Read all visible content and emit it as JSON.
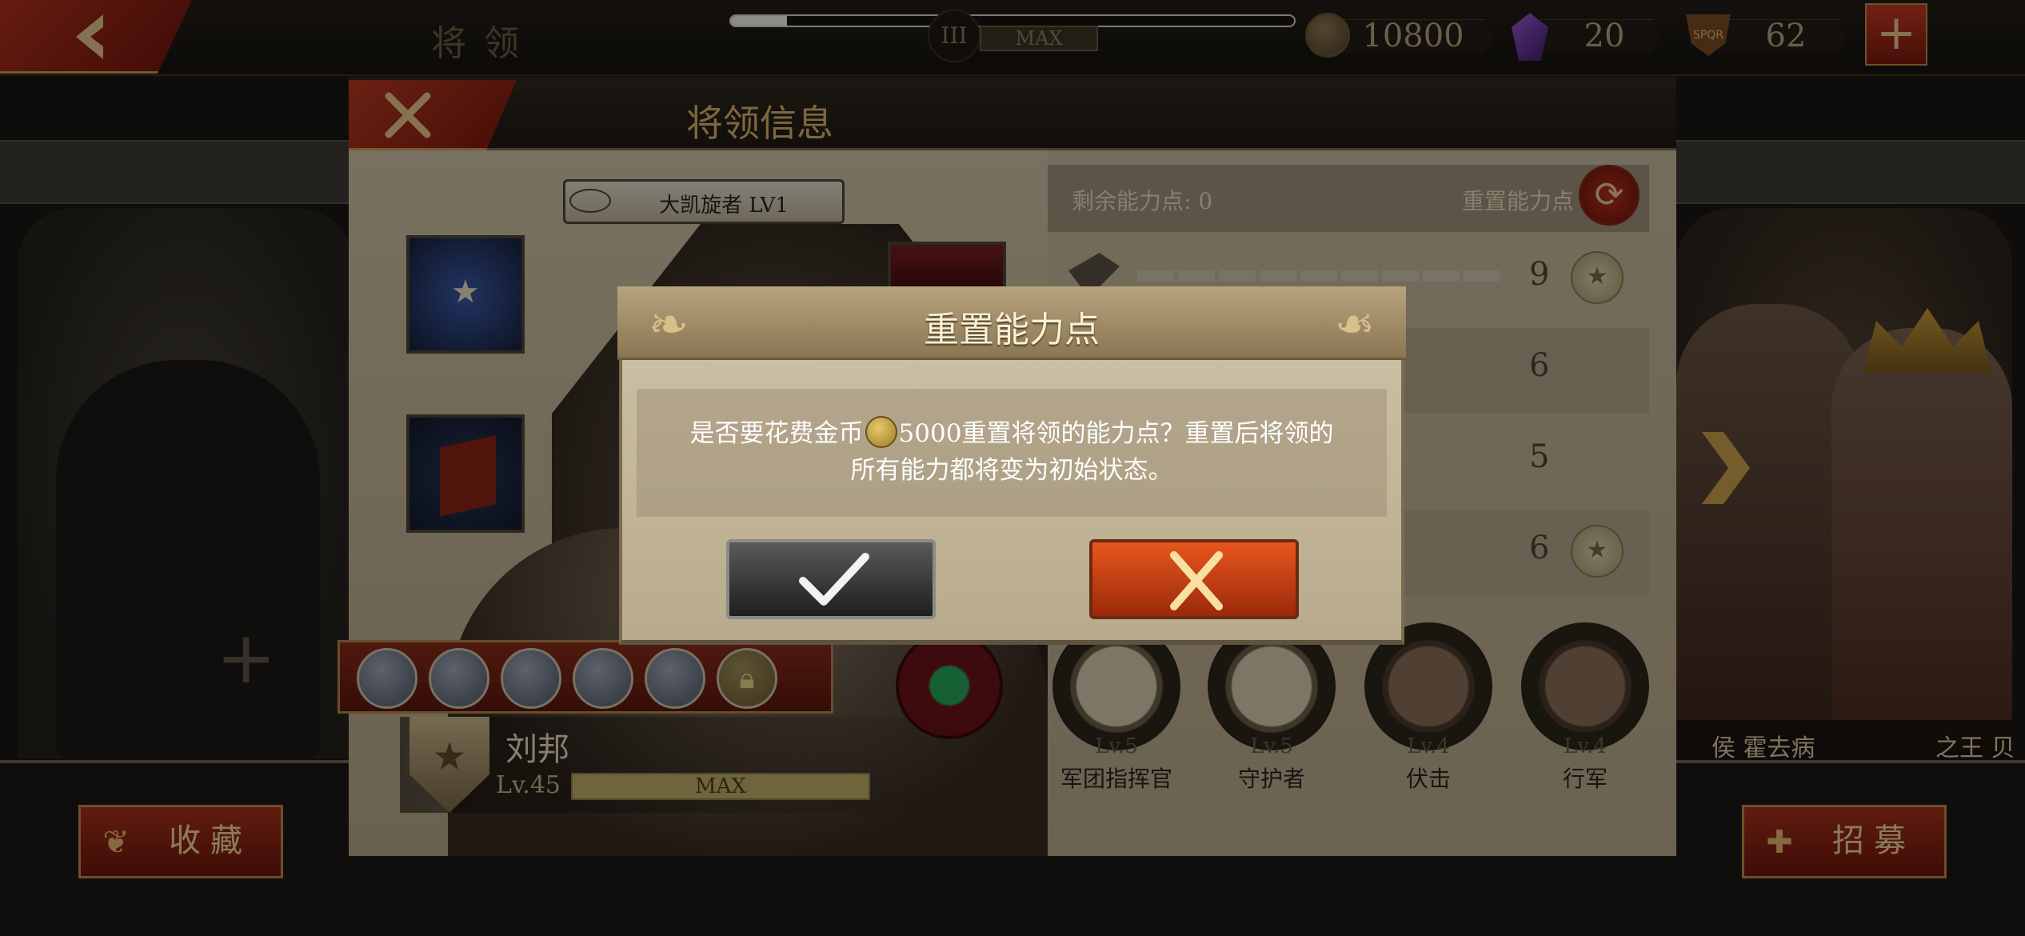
{
  "topbar": {
    "title": "将领",
    "progress_fraction": 0.1,
    "rank_numeral": "III",
    "rank_status": "MAX",
    "gold": "10800",
    "gems": "20",
    "honor": "62",
    "honor_icon_text": "SPQR"
  },
  "general_panel": {
    "title": "将领信息",
    "title_badge": "大凯旋者 LV1",
    "hero_name": "刘邦",
    "hero_level": "Lv.45",
    "level_bar": "MAX",
    "remaining_points": "剩余能力点: 0",
    "reset_points_label": "重置能力点",
    "stats": [
      {
        "value": "9",
        "filled_segments": 9,
        "medal": true
      },
      {
        "value": "6",
        "medal": false
      },
      {
        "value": "5",
        "medal": false
      },
      {
        "value": "6",
        "medal": true
      }
    ],
    "traits": [
      {
        "level": "Lv.5",
        "name": "军团指挥官"
      },
      {
        "level": "Lv.5",
        "name": "守护者"
      },
      {
        "level": "Lv.4",
        "name": "伏击"
      },
      {
        "level": "Lv.4",
        "name": "行军"
      }
    ]
  },
  "background": {
    "right_names": [
      "侯 霍去病",
      "之王 贝"
    ],
    "collect_button": "收藏",
    "recruit_button": "招募"
  },
  "dialog": {
    "title": "重置能力点",
    "line1_before": "是否要花费金币",
    "line1_after": "5000重置将领的能力点？重置后将领的",
    "line2": "所有能力都将变为初始状态。"
  },
  "colors": {
    "accent_red": "#b73a22",
    "gold_text": "#d7b46c",
    "parchment": "#c7b89b"
  }
}
